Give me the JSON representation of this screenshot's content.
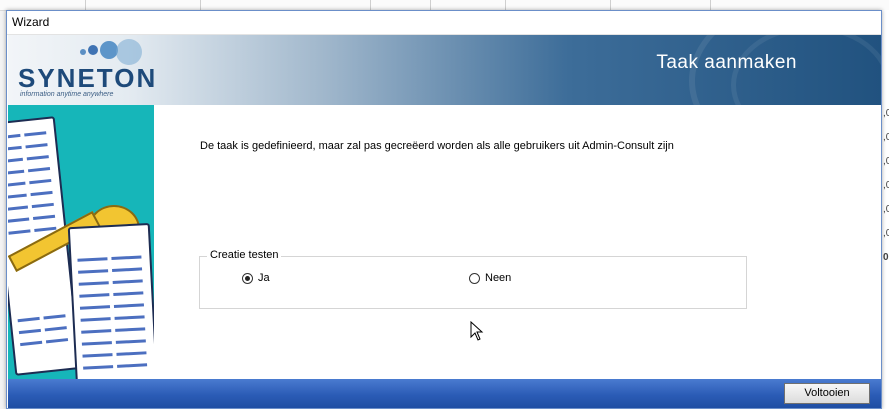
{
  "window": {
    "title": "Wizard"
  },
  "banner": {
    "logo_text": "SYNETON",
    "logo_tagline": "information anytime anywhere",
    "title": "Taak aanmaken"
  },
  "content": {
    "message": "De taak is gedefinieerd, maar zal pas gecreëerd worden als alle gebruikers uit Admin-Consult zijn",
    "group_label": "Creatie testen",
    "options": [
      {
        "label": "Ja",
        "selected": true
      },
      {
        "label": "Neen",
        "selected": false
      }
    ]
  },
  "footer": {
    "finish_label": "Voltooien"
  },
  "background_right_fragments": [
    ",0",
    ",0",
    ",0",
    ",0",
    ",0",
    ",0",
    "0"
  ],
  "colors": {
    "footer_blue": "#2b5cb6",
    "side_teal": "#16b6b9",
    "banner_dark": "#21527f"
  }
}
